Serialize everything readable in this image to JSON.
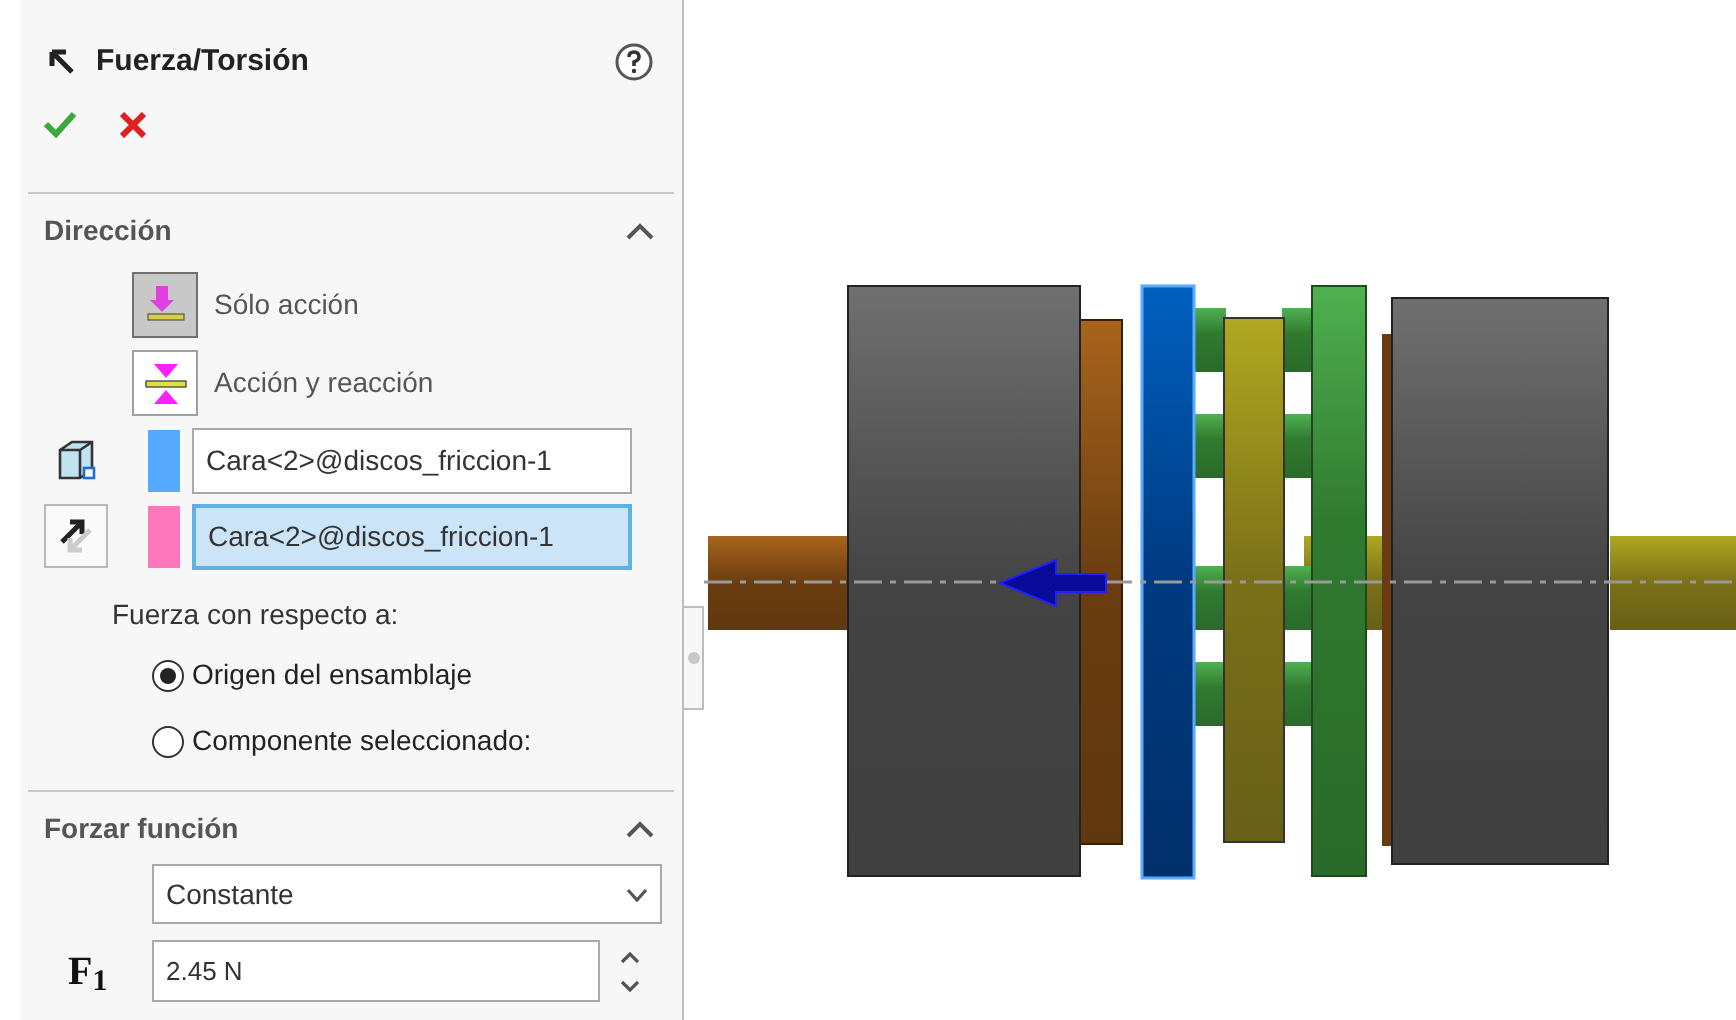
{
  "panel": {
    "title": "Fuerza/Torsión",
    "direction": {
      "title": "Dirección",
      "expanded": true,
      "options": [
        {
          "label": "Sólo acción",
          "selected": true,
          "kind": "action"
        },
        {
          "label": "Acción y reacción",
          "selected": false,
          "kind": "reaction"
        }
      ],
      "selections": [
        {
          "text": "Cara<2>@discos_friccion-1",
          "color": "#55aaff",
          "focused": false,
          "kind": "face"
        },
        {
          "text": "Cara<2>@discos_friccion-1",
          "color": "#ff77bb",
          "focused": true,
          "kind": "reference"
        }
      ],
      "reference_label": "Fuerza con respecto a:",
      "radios": [
        {
          "label": "Origen del ensamblaje",
          "selected": true
        },
        {
          "label": "Componente seleccionado:",
          "selected": false
        }
      ]
    },
    "function": {
      "title": "Forzar función",
      "expanded": true,
      "dropdown": "Constante",
      "symbol": "F$_{1}$",
      "value": "2.45 N"
    }
  }
}
